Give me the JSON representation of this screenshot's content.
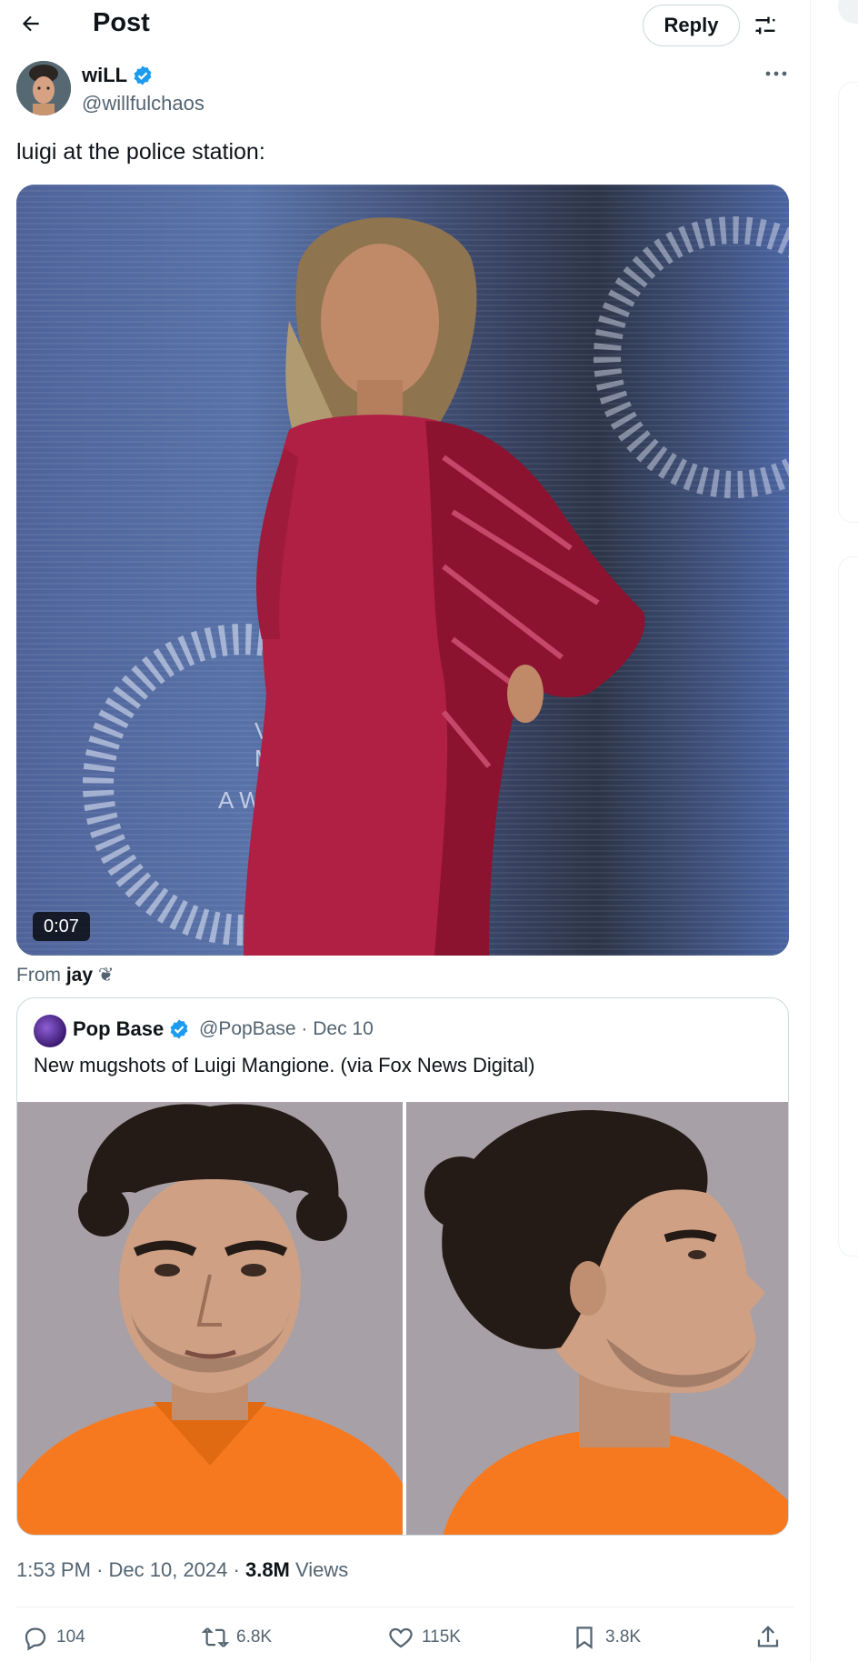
{
  "header": {
    "title": "Post",
    "reply_label": "Reply"
  },
  "author": {
    "name": "wiLL",
    "handle": "@willfulchaos",
    "verified": true
  },
  "tweet": {
    "text": "luigi at the police station:"
  },
  "video": {
    "duration": "0:07",
    "backdrop_letters": "V M A W"
  },
  "from": {
    "prefix": "From",
    "source": "jay",
    "emoji": "❦"
  },
  "quote": {
    "name": "Pop Base",
    "handle": "@PopBase",
    "date": "Dec 10",
    "separator": "·",
    "text": "New mugshots of Luigi Mangione. (via Fox News Digital)"
  },
  "meta": {
    "time": "1:53 PM",
    "date": "Dec 10, 2024",
    "views_count": "3.8M",
    "views_label": "Views",
    "separator": "·"
  },
  "actions": {
    "replies": "104",
    "reposts": "6.8K",
    "likes": "115K",
    "bookmarks": "3.8K"
  },
  "icons": {
    "back": "arrow-left-icon",
    "tune": "sliders-icon",
    "more": "ellipsis-icon",
    "verified": "verified-badge-icon",
    "reply": "reply-icon",
    "repost": "repost-icon",
    "like": "heart-icon",
    "bookmark": "bookmark-icon",
    "share": "share-icon"
  },
  "colors": {
    "accent": "#1d9bf0",
    "text_secondary": "#536471",
    "border": "#cfd9de",
    "jumpsuit": "#f7791f"
  }
}
